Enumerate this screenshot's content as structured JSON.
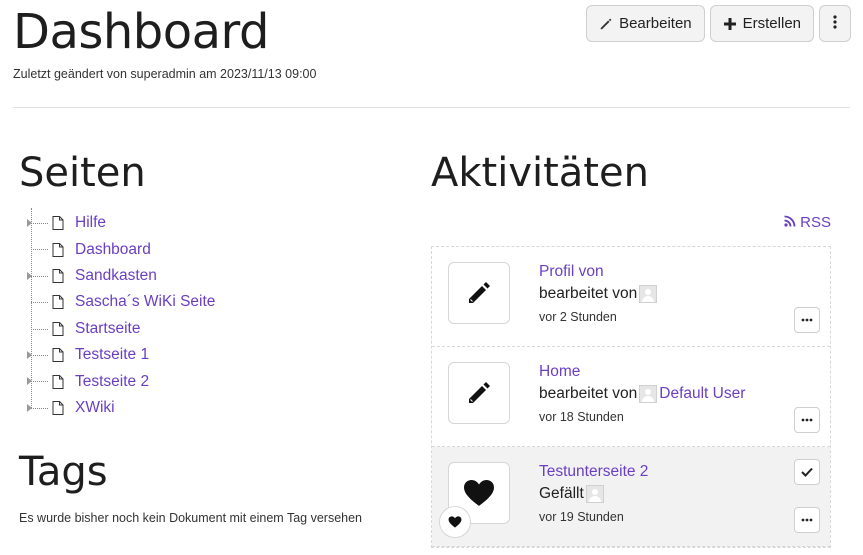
{
  "header": {
    "title": "Dashboard",
    "subtitle": "Zuletzt geändert von superadmin am 2023/11/13 09:00"
  },
  "toolbar": {
    "edit_label": "Bearbeiten",
    "create_label": "Erstellen",
    "edit_icon": "pencil-icon",
    "create_icon": "plus-icon",
    "menu_icon": "vertical-dots-icon"
  },
  "pages": {
    "title": "Seiten",
    "items": [
      {
        "label": "Hilfe",
        "expandable": true
      },
      {
        "label": "Dashboard",
        "expandable": false
      },
      {
        "label": "Sandkasten",
        "expandable": true
      },
      {
        "label": "Sascha´s WiKi Seite",
        "expandable": false
      },
      {
        "label": "Startseite",
        "expandable": false
      },
      {
        "label": "Testseite 1",
        "expandable": true
      },
      {
        "label": "Testseite 2",
        "expandable": true
      },
      {
        "label": "XWiki",
        "expandable": true
      }
    ]
  },
  "tags": {
    "title": "Tags",
    "empty_text": "Es wurde bisher noch kein Dokument mit einem Tag versehen"
  },
  "activities": {
    "title": "Aktivitäten",
    "rss_label": "RSS",
    "items": [
      {
        "title": "Profil von",
        "action": "bearbeitet von",
        "user": "",
        "time": "vor 2 Stunden",
        "icon": "pencil-icon"
      },
      {
        "title": "Home",
        "action": "bearbeitet von",
        "user": "Default User",
        "time": "vor 18 Stunden",
        "icon": "pencil-icon"
      },
      {
        "title": "Testunterseite 2",
        "action": "Gefällt",
        "user": "",
        "time": "vor 19 Stunden",
        "icon": "heart-icon"
      }
    ]
  },
  "colors": {
    "link": "#6a3fc2",
    "button_bg": "#f3f3f3",
    "liked_row_bg": "#f2f2f2"
  }
}
